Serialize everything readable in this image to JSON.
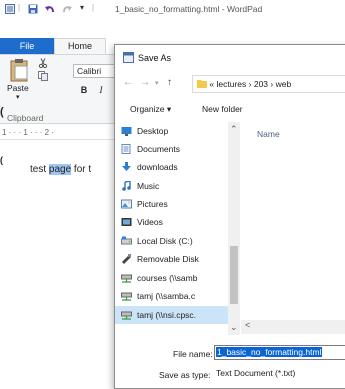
{
  "wordpad": {
    "title": "1_basic_no_formatting.html - WordPad",
    "tabs": {
      "file": "File",
      "home": "Home"
    },
    "paste_label": "Paste",
    "clipboard_label": "Clipboard",
    "font_name": "Calibri",
    "bold_label": "B",
    "italic_label": "I",
    "ruler_text": "1 · · · 1 · · · 2 ·",
    "doc_text_before": "test ",
    "doc_text_selected": "page",
    "doc_text_after": " for t"
  },
  "dialog": {
    "title": "Save As",
    "address": {
      "prefix": "«",
      "folder1": "lectures",
      "folder2": "203",
      "folder3": "web",
      "sep": "›"
    },
    "toolbar": {
      "organize": "Organize ▾",
      "new_folder": "New folder"
    },
    "nav_items": [
      {
        "label": "Desktop",
        "icon": "desktop-icon"
      },
      {
        "label": "Documents",
        "icon": "documents-icon"
      },
      {
        "label": "downloads",
        "icon": "download-icon"
      },
      {
        "label": "Music",
        "icon": "music-icon"
      },
      {
        "label": "Pictures",
        "icon": "pictures-icon"
      },
      {
        "label": "Videos",
        "icon": "videos-icon"
      },
      {
        "label": "Local Disk (C:)",
        "icon": "drive-icon"
      },
      {
        "label": "Removable Disk",
        "icon": "removable-disk-icon"
      },
      {
        "label": "courses (\\\\samb",
        "icon": "network-drive-icon"
      },
      {
        "label": "tamj (\\\\samba.c",
        "icon": "network-drive-icon"
      },
      {
        "label": "tamj (\\\\nsi.cpsc.",
        "icon": "network-drive-icon"
      }
    ],
    "column_name": "Name",
    "file_name_label": "File name:",
    "file_name_value": "1_basic_no_formatting.html",
    "save_type_label": "Save as type:",
    "save_type_value": "Text Document (*.txt)"
  },
  "colors": {
    "accent": "#1e6ccb",
    "selection": "#cce4f7",
    "folder": "#f2c94c"
  }
}
